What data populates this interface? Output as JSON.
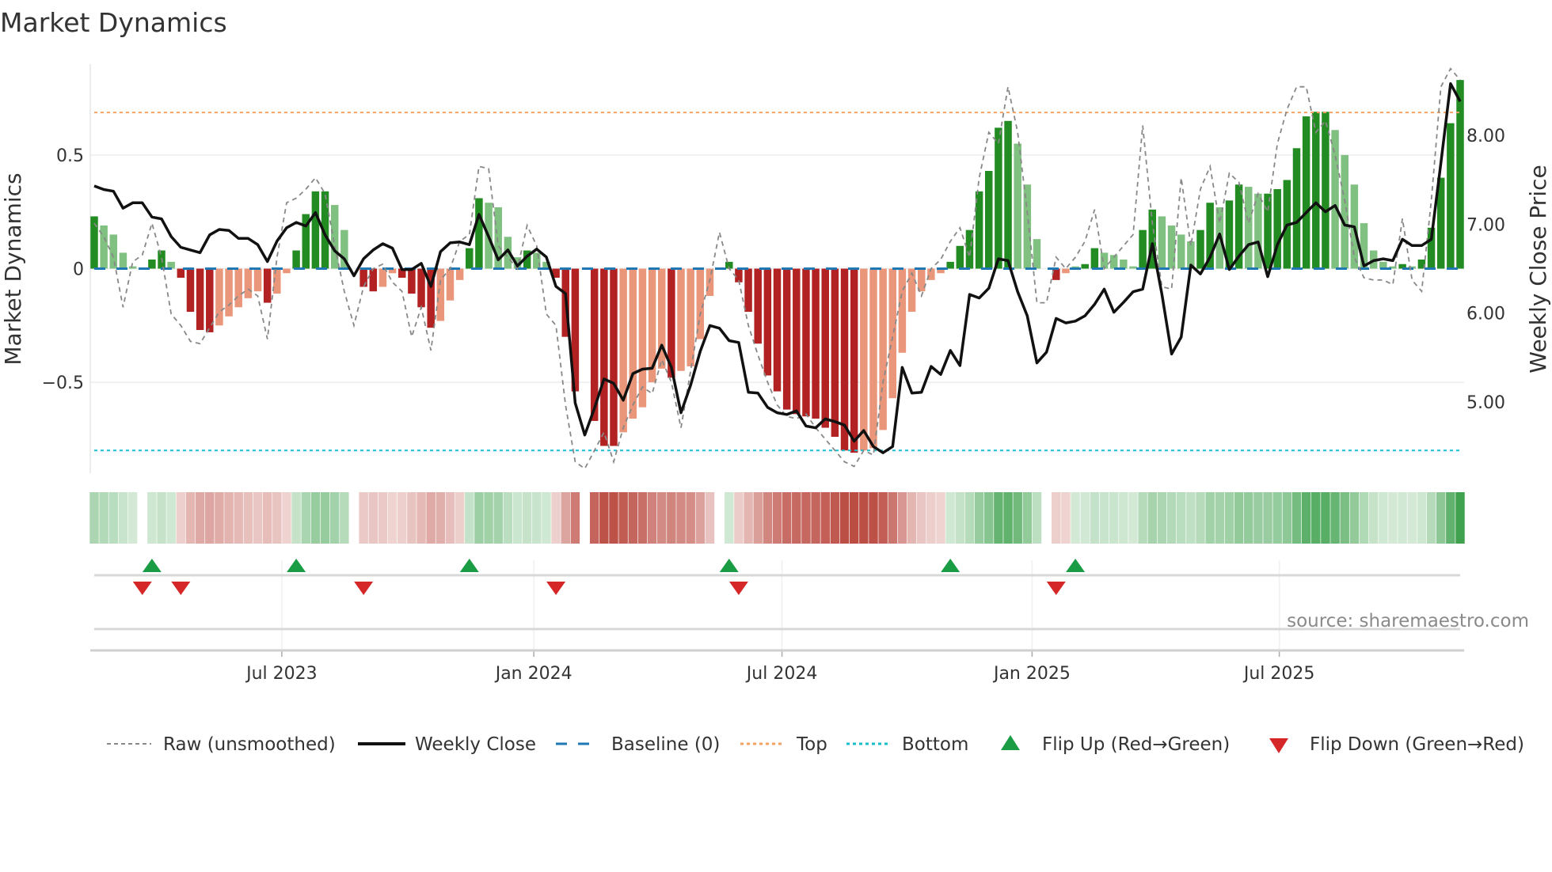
{
  "chart_data": {
    "type": "bar",
    "title": "Market Dynamics",
    "ylabel": "Market Dynamics",
    "y2label": "Weekly Close Price",
    "ylim": [
      -0.9,
      0.9
    ],
    "y2lim": [
      4.2,
      8.8
    ],
    "y_ticks": [
      {
        "value": 0.5,
        "label": "0.5"
      },
      {
        "value": 0,
        "label": "0"
      },
      {
        "value": -0.5,
        "label": "−0.5"
      }
    ],
    "y2_ticks": [
      {
        "value": 8,
        "label": "8.00"
      },
      {
        "value": 7,
        "label": "7.00"
      },
      {
        "value": 6,
        "label": "6.00"
      },
      {
        "value": 5,
        "label": "5.00"
      }
    ],
    "x_ticks": [
      {
        "week": 19.5,
        "label": "Jul 2023"
      },
      {
        "week": 45.7,
        "label": "Jan 2024"
      },
      {
        "week": 71.5,
        "label": "Jul 2024"
      },
      {
        "week": 97.5,
        "label": "Jan 2025"
      },
      {
        "week": 123.2,
        "label": "Jul 2025"
      }
    ],
    "top_level": 0.687,
    "bottom_level": -0.8,
    "baseline": 0,
    "bars": [
      0.23,
      0.19,
      0.15,
      0.07,
      0.01,
      0.0,
      0.04,
      0.08,
      0.03,
      -0.04,
      -0.19,
      -0.27,
      -0.28,
      -0.25,
      -0.21,
      -0.17,
      -0.13,
      -0.1,
      -0.15,
      -0.11,
      -0.02,
      0.08,
      0.24,
      0.34,
      0.34,
      0.28,
      0.17,
      0.0,
      -0.08,
      -0.1,
      -0.08,
      -0.02,
      -0.04,
      -0.11,
      -0.17,
      -0.26,
      -0.23,
      -0.14,
      -0.05,
      0.09,
      0.31,
      0.29,
      0.27,
      0.14,
      0.05,
      0.08,
      0.07,
      0.03,
      -0.04,
      -0.3,
      -0.54,
      0.0,
      -0.67,
      -0.78,
      -0.78,
      -0.72,
      -0.66,
      -0.61,
      -0.5,
      -0.44,
      -0.48,
      -0.45,
      -0.43,
      -0.31,
      -0.12,
      0.0,
      0.03,
      -0.06,
      -0.19,
      -0.33,
      -0.47,
      -0.54,
      -0.62,
      -0.64,
      -0.65,
      -0.66,
      -0.7,
      -0.74,
      -0.8,
      -0.81,
      -0.8,
      -0.79,
      -0.71,
      -0.57,
      -0.37,
      -0.19,
      -0.1,
      -0.05,
      -0.02,
      0.03,
      0.1,
      0.17,
      0.34,
      0.43,
      0.62,
      0.65,
      0.55,
      0.37,
      0.13,
      0.0,
      -0.05,
      -0.02,
      0.01,
      0.02,
      0.09,
      0.07,
      0.06,
      0.04,
      0.01,
      0.17,
      0.26,
      0.23,
      0.19,
      0.15,
      0.12,
      0.17,
      0.29,
      0.27,
      0.3,
      0.37,
      0.36,
      0.33,
      0.33,
      0.35,
      0.39,
      0.53,
      0.67,
      0.69,
      0.69,
      0.61,
      0.5,
      0.37,
      0.2,
      0.08,
      0.03,
      0.01,
      0.02,
      0.01,
      0.04,
      0.18,
      0.4,
      0.64,
      0.83
    ],
    "raw": [
      0.2,
      0.14,
      0.05,
      -0.17,
      0.03,
      0.06,
      0.2,
      0.05,
      -0.2,
      -0.25,
      -0.32,
      -0.33,
      -0.26,
      -0.19,
      -0.16,
      -0.12,
      -0.09,
      -0.12,
      -0.31,
      0.05,
      0.29,
      0.31,
      0.35,
      0.4,
      0.33,
      0.1,
      -0.1,
      -0.25,
      -0.08,
      0.0,
      0.02,
      -0.06,
      -0.1,
      -0.3,
      -0.17,
      -0.36,
      -0.05,
      0.0,
      0.12,
      0.15,
      0.45,
      0.44,
      0.1,
      0.05,
      0.0,
      0.19,
      0.1,
      -0.2,
      -0.25,
      -0.6,
      -0.85,
      -0.88,
      -0.8,
      -0.72,
      -0.85,
      -0.7,
      -0.6,
      -0.52,
      -0.55,
      -0.4,
      -0.5,
      -0.7,
      -0.45,
      -0.2,
      -0.05,
      0.16,
      0.0,
      -0.05,
      -0.25,
      -0.38,
      -0.5,
      -0.6,
      -0.65,
      -0.66,
      -0.64,
      -0.7,
      -0.75,
      -0.8,
      -0.85,
      -0.87,
      -0.8,
      -0.82,
      -0.5,
      -0.3,
      -0.1,
      -0.02,
      -0.12,
      0.0,
      0.04,
      0.12,
      0.18,
      0.05,
      0.4,
      0.6,
      0.55,
      0.8,
      0.6,
      0.25,
      -0.15,
      -0.15,
      0.05,
      0.0,
      0.05,
      0.12,
      0.26,
      0.0,
      0.05,
      0.1,
      0.15,
      0.63,
      0.2,
      -0.08,
      -0.09,
      0.4,
      0.1,
      0.35,
      0.45,
      0.2,
      0.42,
      0.38,
      0.2,
      0.33,
      0.25,
      0.55,
      0.7,
      0.8,
      0.8,
      0.6,
      0.65,
      0.5,
      0.3,
      0.05,
      -0.04,
      -0.05,
      -0.05,
      -0.07,
      0.22,
      -0.05,
      -0.1,
      0.3,
      0.8,
      0.88,
      0.83
    ],
    "weekly_close": [
      7.43,
      7.39,
      7.37,
      7.18,
      7.24,
      7.24,
      7.08,
      7.06,
      6.86,
      6.74,
      6.71,
      6.68,
      6.88,
      6.94,
      6.93,
      6.84,
      6.84,
      6.77,
      6.58,
      6.81,
      6.96,
      7.02,
      6.98,
      7.13,
      6.88,
      6.7,
      6.61,
      6.42,
      6.61,
      6.71,
      6.78,
      6.73,
      6.49,
      6.49,
      6.56,
      6.3,
      6.69,
      6.79,
      6.8,
      6.77,
      7.11,
      6.86,
      6.6,
      6.71,
      6.53,
      6.64,
      6.72,
      6.63,
      6.3,
      6.22,
      4.99,
      4.63,
      4.93,
      5.26,
      5.21,
      5.02,
      5.32,
      5.37,
      5.38,
      5.64,
      5.39,
      4.88,
      5.19,
      5.57,
      5.86,
      5.83,
      5.69,
      5.67,
      5.11,
      5.1,
      4.94,
      4.88,
      4.86,
      4.9,
      4.73,
      4.71,
      4.81,
      4.78,
      4.74,
      4.56,
      4.68,
      4.5,
      4.43,
      4.5,
      5.39,
      5.1,
      5.11,
      5.4,
      5.31,
      5.58,
      5.41,
      6.21,
      6.17,
      6.28,
      6.61,
      6.59,
      6.24,
      5.97,
      5.44,
      5.56,
      5.94,
      5.89,
      5.91,
      5.97,
      6.1,
      6.27,
      6.01,
      6.12,
      6.24,
      6.27,
      6.78,
      6.21,
      5.54,
      5.73,
      6.54,
      6.44,
      6.63,
      6.89,
      6.49,
      6.64,
      6.77,
      6.8,
      6.41,
      6.77,
      6.99,
      7.02,
      7.13,
      7.24,
      7.14,
      7.21,
      6.99,
      6.97,
      6.53,
      6.59,
      6.61,
      6.59,
      6.83,
      6.76,
      6.76,
      6.83,
      7.69,
      8.58,
      8.38
    ],
    "flip_up_weeks": [
      6,
      21,
      39,
      66,
      89,
      102
    ],
    "flip_down_weeks": [
      5,
      9,
      28,
      48,
      67,
      100
    ],
    "legend": {
      "placement": "bottom",
      "raw": "Raw (unsmoothed)",
      "close": "Weekly Close",
      "baseline": "Baseline (0)",
      "top": "Top",
      "bottom": "Bottom",
      "flip_up": "Flip Up (Red→Green)",
      "flip_down": "Flip Down (Green→Red)"
    },
    "source": "source: sharemaestro.com",
    "colors": {
      "green_strong": "#228b22",
      "green_weak": "#80c080",
      "red_strong": "#b22222",
      "red_weak": "#e9967a",
      "raw": "#888888",
      "close": "#111111",
      "baseline": "#1f77b4",
      "top": "#f4a261",
      "bottom": "#17becf",
      "flip_up": "#1a9c45",
      "flip_down": "#d62728"
    }
  }
}
